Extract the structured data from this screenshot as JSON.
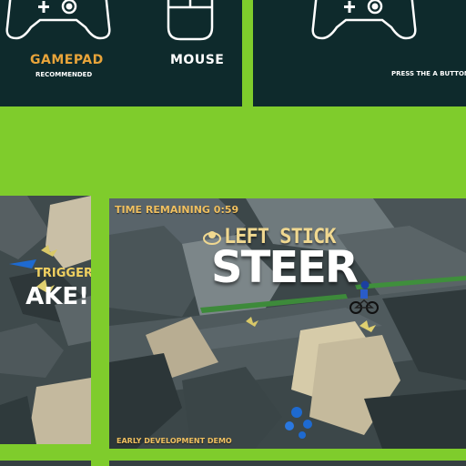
{
  "input_select": {
    "options": [
      {
        "label": "GAMEPAD",
        "sublabel": "RECOMMENDED",
        "icon": "gamepad-icon",
        "highlighted": true
      },
      {
        "label": "MOUSE",
        "icon": "mouse-icon",
        "highlighted": false
      }
    ],
    "highlight_color": "#e8a43a",
    "panel_color": "#0e2a2c"
  },
  "input_select_b": {
    "icon": "gamepad-icon",
    "prompt": "PRESS THE A BUTTON TO CONT"
  },
  "gameplay": {
    "timer": "TIME REMAINING 0:59",
    "hint": "LEFT STICK",
    "action": "STEER",
    "demo_label": "EARLY DEVELOPMENT DEMO",
    "hud_accent_color": "#f0c060"
  },
  "gameplay_left": {
    "partial_hint": "TRIGGER",
    "partial_action": "AKE!"
  },
  "background_color": "#7fcc2c"
}
